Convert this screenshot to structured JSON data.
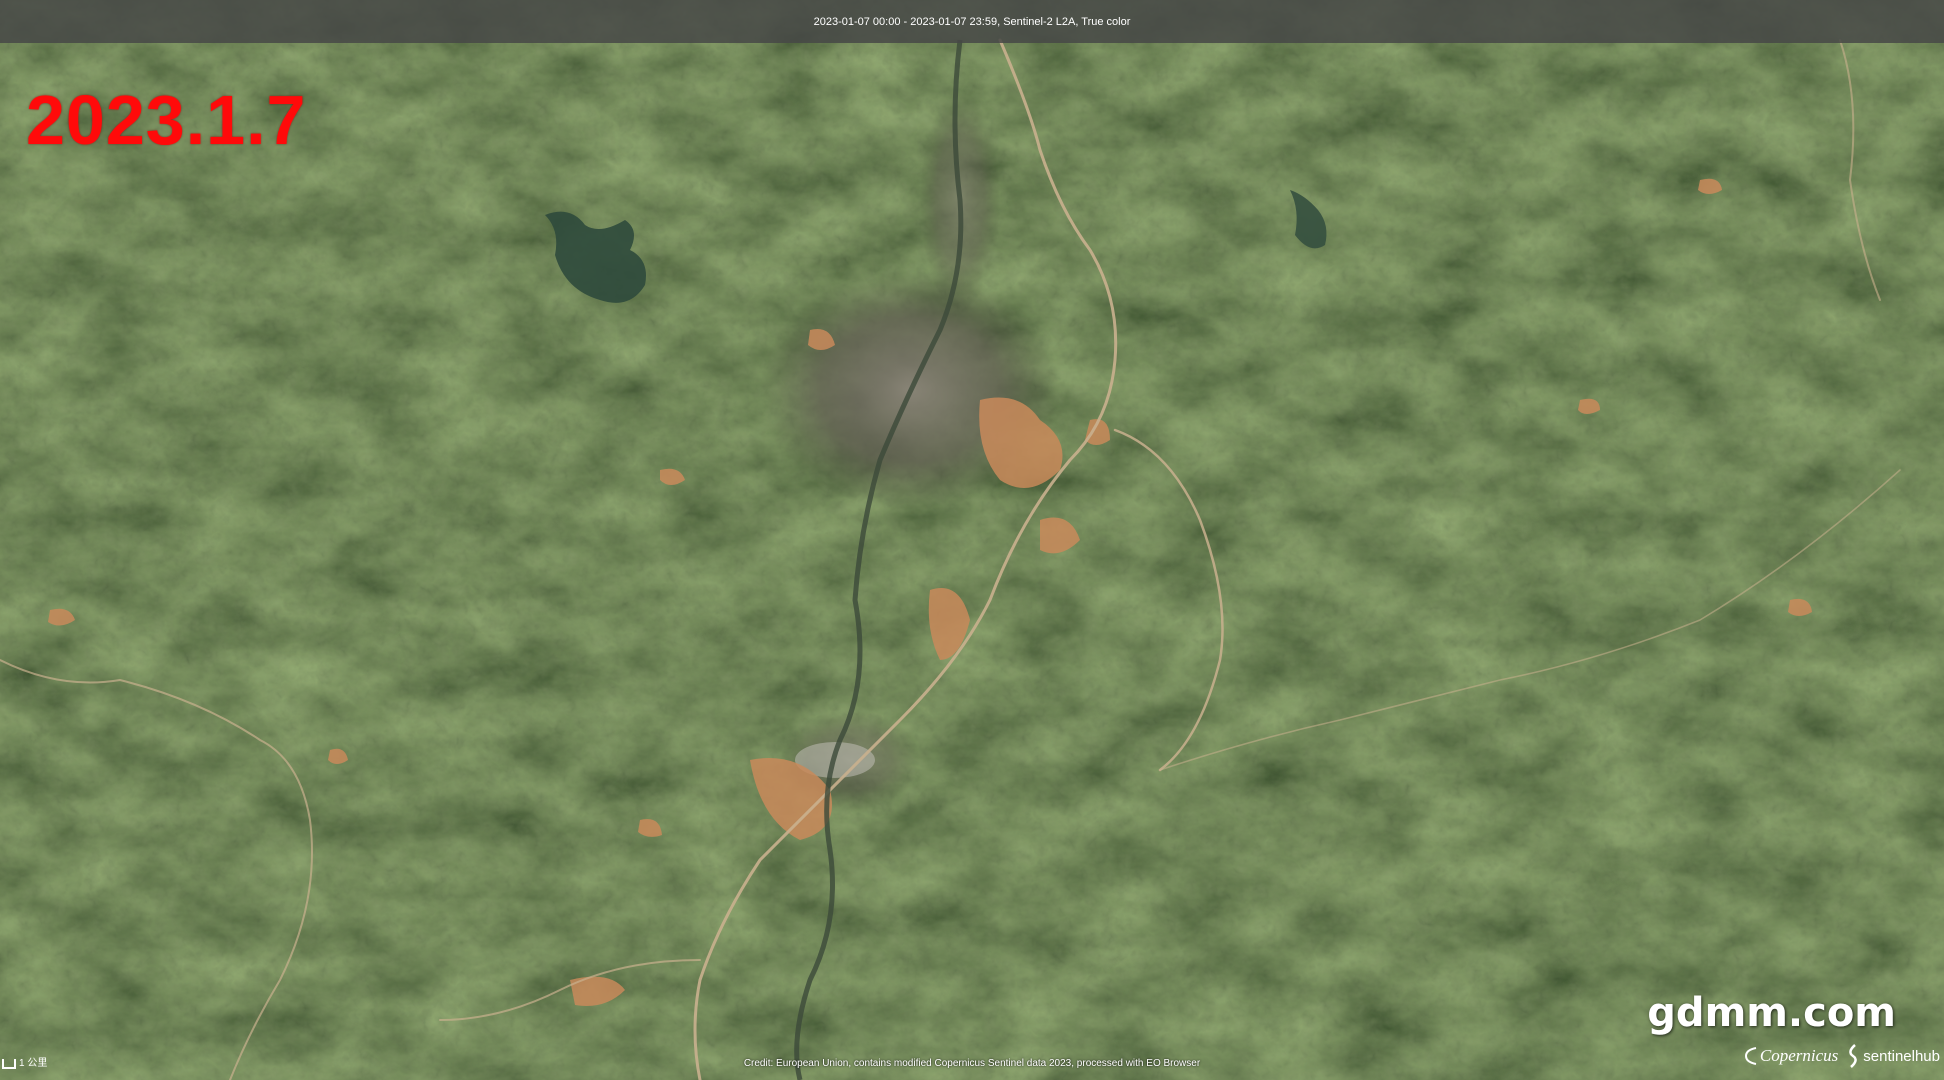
{
  "header": {
    "info": "2023-01-07 00:00 - 2023-01-07 23:59, Sentinel-2 L2A, True color"
  },
  "overlay": {
    "date_label": "2023.1.7",
    "watermark": "gdmm.com"
  },
  "footer": {
    "credit": "Credit: European Union, contains modified Copernicus Sentinel data 2023, processed with EO Browser",
    "scale_label": "1 公里",
    "logos": {
      "copernicus": "Copernicus",
      "sentinelhub": "sentinelhub"
    }
  },
  "map": {
    "type": "satellite-true-color",
    "colors": {
      "forest": "#1f3319",
      "forest_light": "#3b5227",
      "urban": "#7a7468",
      "bare_soil": "#c98a5a",
      "road": "#c9b08e",
      "water": "#2f4a3c"
    }
  }
}
